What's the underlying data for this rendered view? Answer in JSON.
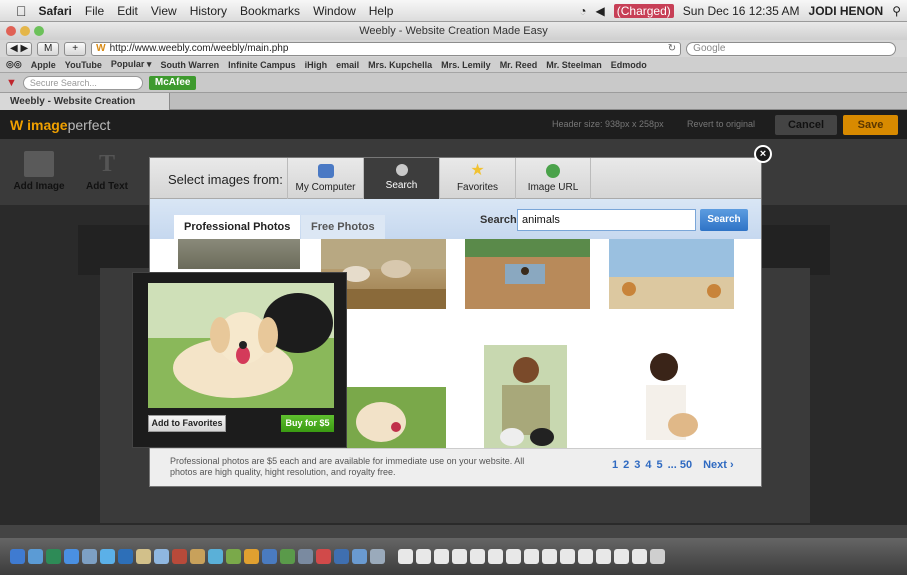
{
  "menubar": {
    "app": "Safari",
    "items": [
      "File",
      "Edit",
      "View",
      "History",
      "Bookmarks",
      "Window",
      "Help"
    ],
    "battery": "(Charged)",
    "datetime": "Sun Dec 16 12:35 AM",
    "user": "JODI HENON"
  },
  "window": {
    "title": "Weebly - Website Creation Made Easy"
  },
  "toolbar": {
    "url": "http://www.weebly.com/weebly/main.php",
    "search_placeholder": "Google"
  },
  "bookmarks": [
    "Apple",
    "YouTube",
    "Popular ▾",
    "South Warren",
    "Infinite Campus",
    "iHigh",
    "email",
    "Mrs. Kupchella",
    "Mrs. Lemily",
    "Mr. Reed",
    "Mr. Steelman",
    "Edmodo"
  ],
  "mcafee": {
    "search_placeholder": "Secure Search...",
    "label": "McAfee"
  },
  "tab": {
    "label": "Weebly - Website Creation Made..."
  },
  "weebly": {
    "logo_bold": "image",
    "logo_rest": "perfect",
    "header_size": "Header size: 938px x 258px",
    "revert": "Revert to original",
    "cancel": "Cancel",
    "save": "Save",
    "tools": [
      "Add Image",
      "Add Text"
    ]
  },
  "modal": {
    "select_label": "Select images from:",
    "sources": [
      {
        "label": "My Computer",
        "color": "#4a79c4"
      },
      {
        "label": "Search",
        "color": "#c9c9c9"
      },
      {
        "label": "Favorites",
        "color": "#f1c232"
      },
      {
        "label": "Image URL",
        "color": "#4aa24a"
      }
    ],
    "tabs": [
      "Professional Photos",
      "Free Photos"
    ],
    "search_label": "Search",
    "search_value": "animals",
    "search_button": "Search",
    "note": "Professional photos are $5 each and are available for immediate use on your website. All photos are high quality, hight resolution, and royalty free.",
    "pages": [
      "1",
      "2",
      "3",
      "4",
      "5",
      "... 50"
    ],
    "next": "Next ›"
  },
  "preview": {
    "favorites": "Add to Favorites",
    "buy": "Buy for $5"
  }
}
